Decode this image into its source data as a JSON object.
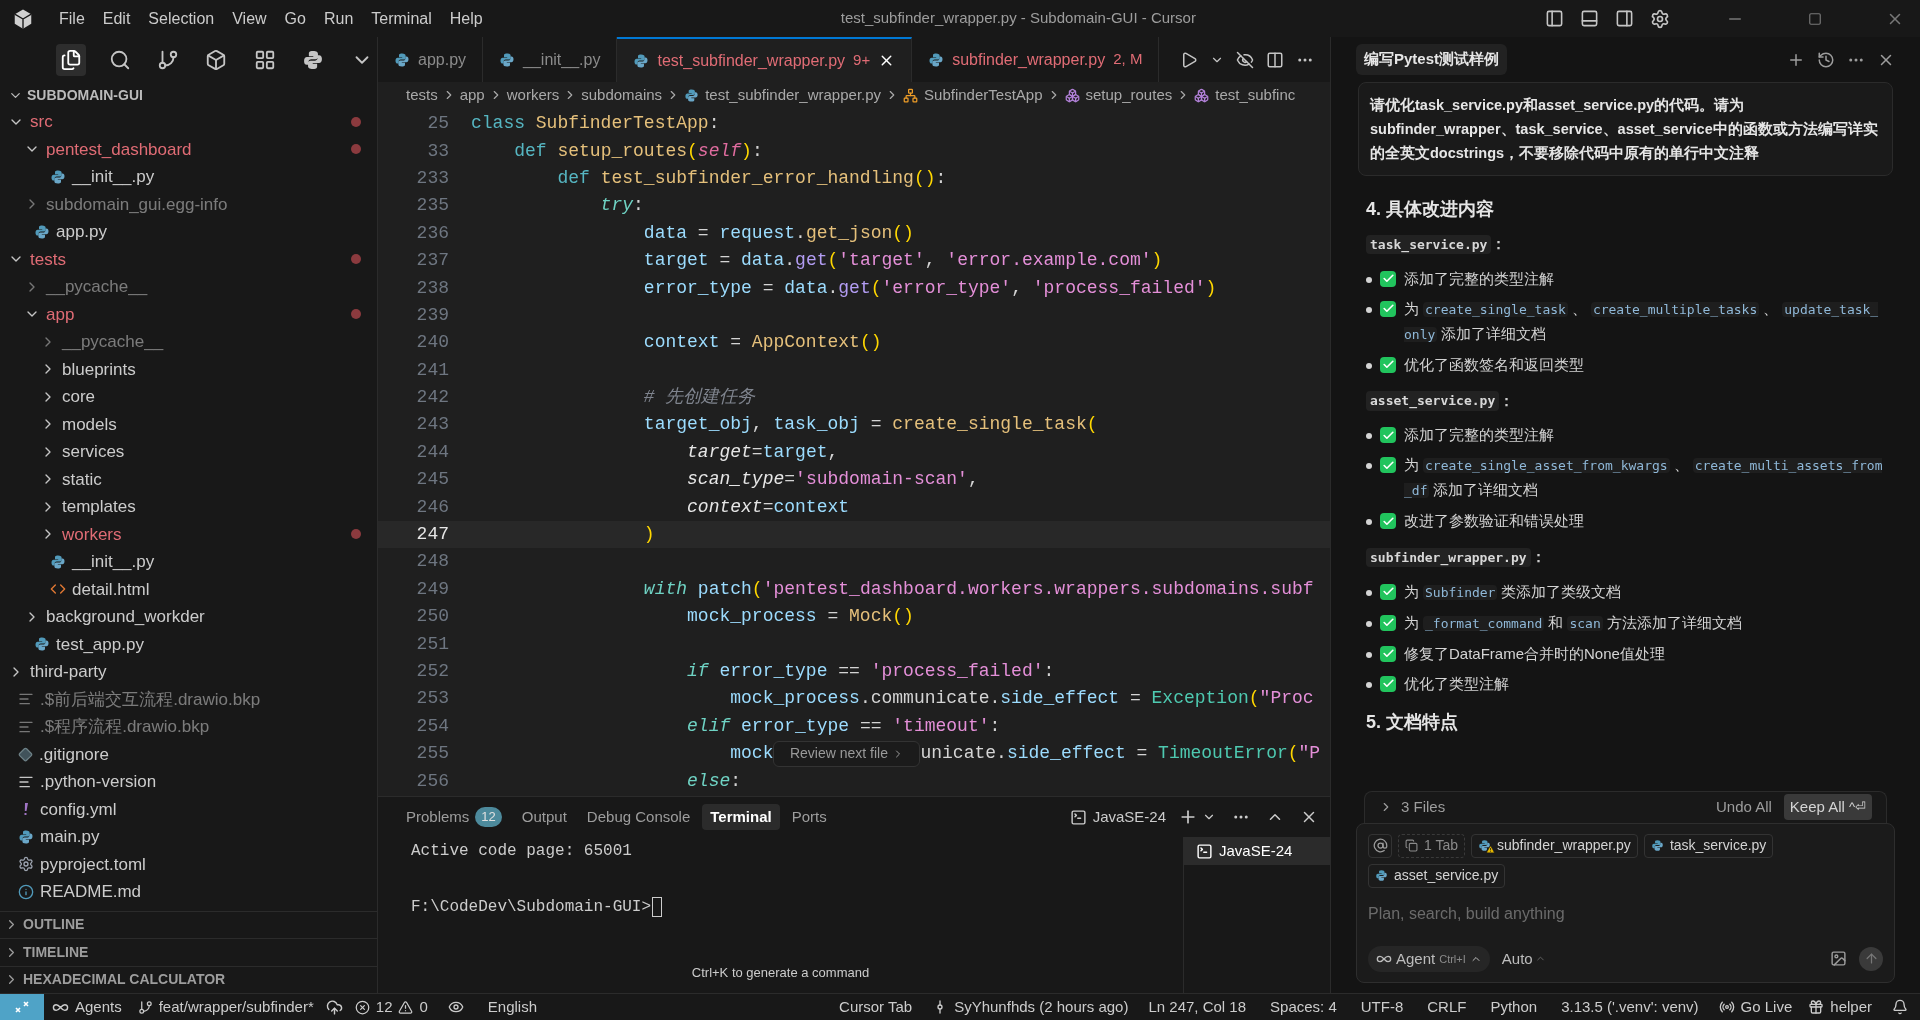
{
  "title_bar": {
    "menu": [
      "File",
      "Edit",
      "Selection",
      "View",
      "Go",
      "Run",
      "Terminal",
      "Help"
    ],
    "title": "test_subfinder_wrapper.py - Subdomain-GUI - Cursor"
  },
  "activity_bar": [
    {
      "kind": "explorer",
      "selected": true
    },
    {
      "kind": "search",
      "selected": false
    },
    {
      "kind": "source_control",
      "selected": false
    },
    {
      "kind": "cube",
      "selected": false
    },
    {
      "kind": "extensions",
      "selected": false
    },
    {
      "kind": "python",
      "selected": false
    },
    {
      "kind": "more",
      "selected": false
    }
  ],
  "explorer": {
    "title": "SUBDOMAIN-GUI",
    "tree": [
      {
        "name": "src",
        "kind": "folder",
        "expanded": true,
        "modified": true,
        "ignored": false,
        "children": [
          {
            "name": "pentest_dashboard",
            "kind": "folder",
            "expanded": true,
            "modified": true,
            "ignored": false,
            "children": [
              {
                "name": "__init__.py",
                "kind": "python",
                "modified": false,
                "ignored": false
              }
            ]
          },
          {
            "name": "subdomain_gui.egg-info",
            "kind": "folder",
            "expanded": false,
            "modified": false,
            "ignored": true
          },
          {
            "name": "app.py",
            "kind": "python",
            "modified": false,
            "ignored": false
          }
        ]
      },
      {
        "name": "tests",
        "kind": "folder",
        "expanded": true,
        "modified": true,
        "ignored": false,
        "children": [
          {
            "name": "__pycache__",
            "kind": "folder",
            "expanded": false,
            "modified": false,
            "ignored": true
          },
          {
            "name": "app",
            "kind": "folder",
            "expanded": true,
            "modified": true,
            "ignored": false,
            "children": [
              {
                "name": "__pycache__",
                "kind": "folder",
                "expanded": false,
                "modified": false,
                "ignored": true
              },
              {
                "name": "blueprints",
                "kind": "folder",
                "expanded": false,
                "modified": false,
                "ignored": false
              },
              {
                "name": "core",
                "kind": "folder",
                "expanded": false,
                "modified": false,
                "ignored": false
              },
              {
                "name": "models",
                "kind": "folder",
                "expanded": false,
                "modified": false,
                "ignored": false
              },
              {
                "name": "services",
                "kind": "folder",
                "expanded": false,
                "modified": false,
                "ignored": false
              },
              {
                "name": "static",
                "kind": "folder",
                "expanded": false,
                "modified": false,
                "ignored": false
              },
              {
                "name": "templates",
                "kind": "folder",
                "expanded": false,
                "modified": false,
                "ignored": false
              },
              {
                "name": "workers",
                "kind": "folder",
                "expanded": false,
                "modified": true,
                "ignored": false
              },
              {
                "name": "__init__.py",
                "kind": "python",
                "modified": false,
                "ignored": false
              },
              {
                "name": "detail.html",
                "kind": "html",
                "modified": false,
                "ignored": false
              }
            ]
          },
          {
            "name": "background_workder",
            "kind": "folder",
            "expanded": false,
            "modified": false,
            "ignored": false
          },
          {
            "name": "test_app.py",
            "kind": "python",
            "modified": false,
            "ignored": false
          }
        ]
      },
      {
        "name": "third-party",
        "kind": "folder",
        "expanded": false,
        "modified": false,
        "ignored": false
      },
      {
        "name": ".$前后端交互流程.drawio.bkp",
        "kind": "text",
        "modified": false,
        "ignored": true
      },
      {
        "name": ".$程序流程.drawio.bkp",
        "kind": "text",
        "modified": false,
        "ignored": true
      },
      {
        "name": ".gitignore",
        "kind": "git",
        "modified": false,
        "ignored": false
      },
      {
        "name": ".python-version",
        "kind": "text",
        "modified": false,
        "ignored": false
      },
      {
        "name": "config.yml",
        "kind": "yaml",
        "modified": false,
        "ignored": false
      },
      {
        "name": "main.py",
        "kind": "python",
        "modified": false,
        "ignored": false
      },
      {
        "name": "pyproject.toml",
        "kind": "toml",
        "modified": false,
        "ignored": false
      },
      {
        "name": "README.md",
        "kind": "info",
        "modified": false,
        "ignored": false
      }
    ],
    "sections": [
      "OUTLINE",
      "TIMELINE",
      "HEXADECIMAL CALCULATOR"
    ]
  },
  "editor": {
    "tabs": [
      {
        "label": "app.py",
        "selected": false,
        "modified": false
      },
      {
        "label": "__init__.py",
        "selected": false,
        "modified": false
      },
      {
        "label": "test_subfinder_wrapper.py",
        "badge": "9+",
        "selected": true,
        "modified": true
      },
      {
        "label": "subfinder_wrapper.py",
        "badge": "2, M",
        "selected": false,
        "modified": true
      }
    ],
    "breadcrumbs": [
      {
        "label": "tests",
        "kind": "folder"
      },
      {
        "label": "app",
        "kind": "folder"
      },
      {
        "label": "workers",
        "kind": "folder"
      },
      {
        "label": "subdomains",
        "kind": "folder"
      },
      {
        "label": "test_subfinder_wrapper.py",
        "kind": "python"
      },
      {
        "label": "SubfinderTestApp",
        "kind": "class"
      },
      {
        "label": "setup_routes",
        "kind": "method"
      },
      {
        "label": "test_subfinc",
        "kind": "method"
      }
    ],
    "lines": [
      {
        "number": "25",
        "current": false,
        "tokens": [
          {
            "kind": "keyword",
            "text": "class "
          },
          {
            "kind": "class",
            "text": "SubfinderTestApp"
          },
          {
            "kind": "plain",
            "text": ":"
          }
        ]
      },
      {
        "number": "33",
        "current": false,
        "tokens": [
          {
            "kind": "keyword",
            "text": "    def "
          },
          {
            "kind": "function",
            "text": "setup_routes"
          },
          {
            "kind": "bracket",
            "text": "("
          },
          {
            "kind": "self",
            "text": "self"
          },
          {
            "kind": "bracket",
            "text": ")"
          },
          {
            "kind": "plain",
            "text": ":"
          }
        ]
      },
      {
        "number": "233",
        "current": false,
        "tokens": [
          {
            "kind": "keyword",
            "text": "        def "
          },
          {
            "kind": "function",
            "text": "test_subfinder_error_handling"
          },
          {
            "kind": "bracket",
            "text": "()"
          },
          {
            "kind": "plain",
            "text": ":"
          }
        ]
      },
      {
        "number": "235",
        "current": false,
        "tokens": [
          {
            "kind": "control",
            "text": "            try"
          },
          {
            "kind": "plain",
            "text": ":"
          }
        ]
      },
      {
        "number": "236",
        "current": false,
        "tokens": [
          {
            "kind": "variable",
            "text": "                data"
          },
          {
            "kind": "plain",
            "text": " = "
          },
          {
            "kind": "variable",
            "text": "request"
          },
          {
            "kind": "plain",
            "text": "."
          },
          {
            "kind": "function",
            "text": "get_json"
          },
          {
            "kind": "bracket",
            "text": "()"
          }
        ]
      },
      {
        "number": "237",
        "current": false,
        "tokens": [
          {
            "kind": "variable",
            "text": "                target"
          },
          {
            "kind": "plain",
            "text": " = "
          },
          {
            "kind": "variable",
            "text": "data"
          },
          {
            "kind": "plain",
            "text": "."
          },
          {
            "kind": "method",
            "text": "get"
          },
          {
            "kind": "bracket",
            "text": "("
          },
          {
            "kind": "string",
            "text": "'target'"
          },
          {
            "kind": "plain",
            "text": ", "
          },
          {
            "kind": "string",
            "text": "'error.example.com'"
          },
          {
            "kind": "bracket",
            "text": ")"
          }
        ]
      },
      {
        "number": "238",
        "current": false,
        "tokens": [
          {
            "kind": "variable",
            "text": "                error_type"
          },
          {
            "kind": "plain",
            "text": " = "
          },
          {
            "kind": "variable",
            "text": "data"
          },
          {
            "kind": "plain",
            "text": "."
          },
          {
            "kind": "method",
            "text": "get"
          },
          {
            "kind": "bracket",
            "text": "("
          },
          {
            "kind": "string",
            "text": "'error_type'"
          },
          {
            "kind": "plain",
            "text": ", "
          },
          {
            "kind": "string",
            "text": "'process_failed'"
          },
          {
            "kind": "bracket",
            "text": ")"
          }
        ]
      },
      {
        "number": "239",
        "current": false
      },
      {
        "number": "240",
        "current": false,
        "tokens": [
          {
            "kind": "variable",
            "text": "                context"
          },
          {
            "kind": "plain",
            "text": " = "
          },
          {
            "kind": "function",
            "text": "AppContext"
          },
          {
            "kind": "bracket",
            "text": "()"
          }
        ]
      },
      {
        "number": "241",
        "current": false
      },
      {
        "number": "242",
        "current": false,
        "tokens": [
          {
            "kind": "comment",
            "text": "                # 先创建任务"
          }
        ]
      },
      {
        "number": "243",
        "current": false,
        "tokens": [
          {
            "kind": "variable",
            "text": "                target_obj"
          },
          {
            "kind": "plain",
            "text": ", "
          },
          {
            "kind": "variable",
            "text": "task_obj"
          },
          {
            "kind": "plain",
            "text": " = "
          },
          {
            "kind": "function",
            "text": "create_single_task"
          },
          {
            "kind": "bracket",
            "text": "("
          }
        ]
      },
      {
        "number": "244",
        "current": false,
        "tokens": [
          {
            "kind": "parameter",
            "text": "                    target"
          },
          {
            "kind": "plain",
            "text": "="
          },
          {
            "kind": "variable",
            "text": "target"
          },
          {
            "kind": "plain",
            "text": ","
          }
        ]
      },
      {
        "number": "245",
        "current": false,
        "tokens": [
          {
            "kind": "parameter",
            "text": "                    scan_type"
          },
          {
            "kind": "plain",
            "text": "="
          },
          {
            "kind": "string",
            "text": "'subdomain-scan'"
          },
          {
            "kind": "plain",
            "text": ","
          }
        ]
      },
      {
        "number": "246",
        "current": false,
        "tokens": [
          {
            "kind": "parameter",
            "text": "                    context"
          },
          {
            "kind": "plain",
            "text": "="
          },
          {
            "kind": "variable",
            "text": "context"
          }
        ]
      },
      {
        "number": "247",
        "current": true,
        "tokens": [
          {
            "kind": "bracket",
            "text": "                )"
          }
        ]
      },
      {
        "number": "248",
        "current": false
      },
      {
        "number": "249",
        "current": false,
        "tokens": [
          {
            "kind": "control",
            "text": "                with"
          },
          {
            "kind": "variable",
            "text": " patch"
          },
          {
            "kind": "bracket",
            "text": "("
          },
          {
            "kind": "string",
            "text": "'pentest_dashboard.workers.wrappers.subdomains.subf"
          }
        ]
      },
      {
        "number": "250",
        "current": false,
        "tokens": [
          {
            "kind": "variable",
            "text": "                    mock_process"
          },
          {
            "kind": "plain",
            "text": " = "
          },
          {
            "kind": "function",
            "text": "Mock"
          },
          {
            "kind": "bracket",
            "text": "()"
          }
        ]
      },
      {
        "number": "251",
        "current": false
      },
      {
        "number": "252",
        "current": false,
        "tokens": [
          {
            "kind": "control",
            "text": "                    if"
          },
          {
            "kind": "variable",
            "text": " error_type"
          },
          {
            "kind": "plain",
            "text": " == "
          },
          {
            "kind": "string",
            "text": "'process_failed'"
          },
          {
            "kind": "plain",
            "text": ":"
          }
        ]
      },
      {
        "number": "253",
        "current": false,
        "tokens": [
          {
            "kind": "variable",
            "text": "                        mock_process"
          },
          {
            "kind": "plain",
            "text": ".communicate."
          },
          {
            "kind": "variable",
            "text": "side_effect"
          },
          {
            "kind": "plain",
            "text": " = "
          },
          {
            "kind": "type",
            "text": "Exception"
          },
          {
            "kind": "bracket",
            "text": "("
          },
          {
            "kind": "string",
            "text": "\"Proc"
          }
        ]
      },
      {
        "number": "254",
        "current": false,
        "tokens": [
          {
            "kind": "control",
            "text": "                    elif"
          },
          {
            "kind": "variable",
            "text": " error_type"
          },
          {
            "kind": "plain",
            "text": " == "
          },
          {
            "kind": "string",
            "text": "'timeout'"
          },
          {
            "kind": "plain",
            "text": ":"
          }
        ]
      },
      {
        "number": "255",
        "current": false,
        "tokens": [
          {
            "kind": "variable",
            "text": "                        mock"
          },
          {
            "kind": "chip",
            "text": "Review next file"
          },
          {
            "kind": "plain",
            "text": "unicate."
          },
          {
            "kind": "variable",
            "text": "side_effect"
          },
          {
            "kind": "plain",
            "text": " = "
          },
          {
            "kind": "type",
            "text": "TimeoutError"
          },
          {
            "kind": "bracket",
            "text": "("
          },
          {
            "kind": "string",
            "text": "\"P"
          }
        ]
      },
      {
        "number": "256",
        "current": false,
        "tokens": [
          {
            "kind": "control",
            "text": "                    else"
          },
          {
            "kind": "plain",
            "text": ":"
          }
        ]
      }
    ]
  },
  "panel": {
    "tabs": [
      {
        "label": "Problems",
        "badge": "12",
        "selected": false
      },
      {
        "label": "Output",
        "selected": false
      },
      {
        "label": "Debug Console",
        "selected": false
      },
      {
        "label": "Terminal",
        "selected": true
      },
      {
        "label": "Ports",
        "selected": false
      }
    ],
    "terminal_name": "JavaSE-24",
    "output": [
      "Active code page: 65001",
      "F:\\CodeDev\\Subdomain-GUI>"
    ],
    "terminals": [
      {
        "label": "JavaSE-24",
        "selected": true
      }
    ],
    "hint": "Ctrl+K to generate a command"
  },
  "chat": {
    "title": "编写Pytest测试样例",
    "user_message": "请优化task_service.py和asset_service.py的代码。请为subfinder_wrapper、task_service、asset_service中的函数或方法编写详实的全英文docstrings，不要移除代码中原有的单行中文注释",
    "heading": "4. 具体改进内容",
    "sections": [
      {
        "file": "task_service.py",
        "suffix": "：",
        "items": [
          {
            "checked": true,
            "parts": [
              {
                "kind": "text",
                "text": "添加了完整的类型注解"
              }
            ]
          },
          {
            "checked": true,
            "parts": [
              {
                "kind": "text",
                "text": "为"
              },
              {
                "kind": "code",
                "text": "create_single_task"
              },
              {
                "kind": "text",
                "text": "、"
              },
              {
                "kind": "code",
                "text": "create_multiple_tasks"
              },
              {
                "kind": "text",
                "text": "、"
              },
              {
                "kind": "code",
                "text": "update_task_only"
              },
              {
                "kind": "text",
                "text": "添加了详细文档"
              }
            ]
          },
          {
            "checked": true,
            "parts": [
              {
                "kind": "text",
                "text": "优化了函数签名和返回类型"
              }
            ]
          }
        ]
      },
      {
        "file": "asset_service.py",
        "suffix": "：",
        "items": [
          {
            "checked": true,
            "parts": [
              {
                "kind": "text",
                "text": "添加了完整的类型注解"
              }
            ]
          },
          {
            "checked": true,
            "parts": [
              {
                "kind": "text",
                "text": "为"
              },
              {
                "kind": "code",
                "text": "create_single_asset_from_kwargs"
              },
              {
                "kind": "text",
                "text": "、"
              },
              {
                "kind": "code",
                "text": "create_multi_assets_from_df"
              },
              {
                "kind": "text",
                "text": "添加了详细文档"
              }
            ]
          },
          {
            "checked": true,
            "parts": [
              {
                "kind": "text",
                "text": "改进了参数验证和错误处理"
              }
            ]
          }
        ]
      },
      {
        "file": "subfinder_wrapper.py",
        "suffix": "：",
        "items": [
          {
            "checked": true,
            "parts": [
              {
                "kind": "text",
                "text": "为"
              },
              {
                "kind": "code",
                "text": "Subfinder"
              },
              {
                "kind": "text",
                "text": "类添加了类级文档"
              }
            ]
          },
          {
            "checked": true,
            "parts": [
              {
                "kind": "text",
                "text": "为"
              },
              {
                "kind": "code",
                "text": "_format_command"
              },
              {
                "kind": "text",
                "text": "和"
              },
              {
                "kind": "code",
                "text": "scan"
              },
              {
                "kind": "text",
                "text": "方法添加了详细文档"
              }
            ]
          },
          {
            "checked": true,
            "parts": [
              {
                "kind": "text",
                "text": "修复了DataFrame合并时的None值处理"
              }
            ]
          },
          {
            "checked": true,
            "parts": [
              {
                "kind": "text",
                "text": "优化了类型注解"
              }
            ]
          }
        ]
      }
    ],
    "next_heading": "5. 文档特点",
    "changes": {
      "files": "3 Files",
      "undo": "Undo All",
      "keep": "Keep All",
      "keep_shortcut": "^⏎"
    },
    "composer": {
      "context": [
        {
          "kind": "tab",
          "label": "1 Tab",
          "warning": false
        },
        {
          "kind": "file",
          "label": "subfinder_wrapper.py",
          "warning": true
        },
        {
          "kind": "file",
          "label": "task_service.py",
          "warning": false
        },
        {
          "kind": "file",
          "label": "asset_service.py",
          "warning": false
        }
      ],
      "placeholder": "Plan, search, build anything",
      "mode": "Agent",
      "mode_shortcut": "Ctrl+I",
      "model": "Auto"
    }
  },
  "status_bar": {
    "left": [
      {
        "kind": "remote"
      },
      {
        "kind": "agents",
        "label": "Agents"
      },
      {
        "kind": "branch",
        "label": "feat/wrapper/subfinder*"
      },
      {
        "kind": "sync"
      },
      {
        "kind": "problems",
        "errors": "12",
        "warnings": "0"
      },
      {
        "kind": "eye"
      },
      {
        "kind": "text",
        "label": "English"
      }
    ],
    "right": [
      {
        "kind": "text",
        "label": "Cursor Tab"
      },
      {
        "kind": "commit",
        "label": "SyYhunfhds (2 hours ago)"
      },
      {
        "kind": "text",
        "label": "Ln 247, Col 18"
      },
      {
        "kind": "text",
        "label": "Spaces: 4"
      },
      {
        "kind": "text",
        "label": "UTF-8"
      },
      {
        "kind": "text",
        "label": "CRLF"
      },
      {
        "kind": "text",
        "label": "Python"
      },
      {
        "kind": "text",
        "label": "3.13.5 ('.venv': venv)"
      },
      {
        "kind": "golive",
        "label": "Go Live"
      },
      {
        "kind": "helper",
        "label": "helper"
      },
      {
        "kind": "bell"
      }
    ]
  }
}
